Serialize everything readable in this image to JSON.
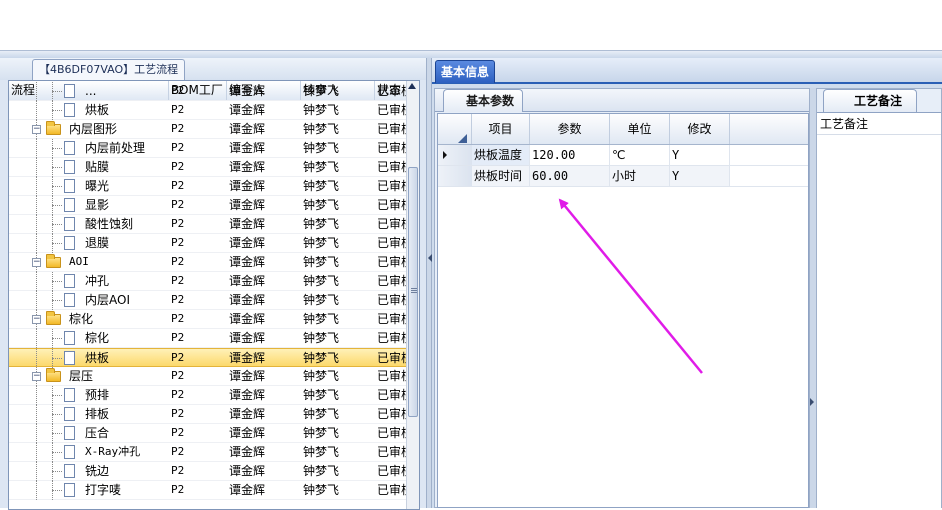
{
  "left_tab_label": "【4B6DF07VAO】工艺流程",
  "tree_grid": {
    "columns": [
      "流程",
      "BOM工厂",
      "编写人",
      "核审人",
      "状态"
    ],
    "rows": [
      {
        "label": "...",
        "level": 2,
        "type": "doc",
        "factory": "P2",
        "writer": "谭金辉",
        "reviewer": "钟梦飞",
        "status": "已审核"
      },
      {
        "label": "烘板",
        "level": 2,
        "type": "doc",
        "factory": "P2",
        "writer": "谭金辉",
        "reviewer": "钟梦飞",
        "status": "已审核"
      },
      {
        "label": "内层图形",
        "level": 1,
        "type": "folder",
        "factory": "P2",
        "writer": "谭金辉",
        "reviewer": "钟梦飞",
        "status": "已审核"
      },
      {
        "label": "内层前处理",
        "level": 2,
        "type": "doc",
        "factory": "P2",
        "writer": "谭金辉",
        "reviewer": "钟梦飞",
        "status": "已审核"
      },
      {
        "label": "贴膜",
        "level": 2,
        "type": "doc",
        "factory": "P2",
        "writer": "谭金辉",
        "reviewer": "钟梦飞",
        "status": "已审核"
      },
      {
        "label": "曝光",
        "level": 2,
        "type": "doc",
        "factory": "P2",
        "writer": "谭金辉",
        "reviewer": "钟梦飞",
        "status": "已审核"
      },
      {
        "label": "显影",
        "level": 2,
        "type": "doc",
        "factory": "P2",
        "writer": "谭金辉",
        "reviewer": "钟梦飞",
        "status": "已审核"
      },
      {
        "label": "酸性蚀刻",
        "level": 2,
        "type": "doc",
        "factory": "P2",
        "writer": "谭金辉",
        "reviewer": "钟梦飞",
        "status": "已审核"
      },
      {
        "label": "退膜",
        "level": 2,
        "type": "doc",
        "factory": "P2",
        "writer": "谭金辉",
        "reviewer": "钟梦飞",
        "status": "已审核"
      },
      {
        "label": "AOI",
        "level": 1,
        "type": "folder",
        "factory": "P2",
        "writer": "谭金辉",
        "reviewer": "钟梦飞",
        "status": "已审核"
      },
      {
        "label": "冲孔",
        "level": 2,
        "type": "doc",
        "factory": "P2",
        "writer": "谭金辉",
        "reviewer": "钟梦飞",
        "status": "已审核"
      },
      {
        "label": "内层AOI",
        "level": 2,
        "type": "doc",
        "factory": "P2",
        "writer": "谭金辉",
        "reviewer": "钟梦飞",
        "status": "已审核"
      },
      {
        "label": "棕化",
        "level": 1,
        "type": "folder",
        "factory": "P2",
        "writer": "谭金辉",
        "reviewer": "钟梦飞",
        "status": "已审核"
      },
      {
        "label": "棕化",
        "level": 2,
        "type": "doc",
        "factory": "P2",
        "writer": "谭金辉",
        "reviewer": "钟梦飞",
        "status": "已审核"
      },
      {
        "label": "烘板",
        "level": 2,
        "type": "doc",
        "factory": "P2",
        "writer": "谭金辉",
        "reviewer": "钟梦飞",
        "status": "已审核",
        "selected": true
      },
      {
        "label": "层压",
        "level": 1,
        "type": "folder",
        "factory": "P2",
        "writer": "谭金辉",
        "reviewer": "钟梦飞",
        "status": "已审核"
      },
      {
        "label": "预排",
        "level": 2,
        "type": "doc",
        "factory": "P2",
        "writer": "谭金辉",
        "reviewer": "钟梦飞",
        "status": "已审核"
      },
      {
        "label": "排板",
        "level": 2,
        "type": "doc",
        "factory": "P2",
        "writer": "谭金辉",
        "reviewer": "钟梦飞",
        "status": "已审核"
      },
      {
        "label": "压合",
        "level": 2,
        "type": "doc",
        "factory": "P2",
        "writer": "谭金辉",
        "reviewer": "钟梦飞",
        "status": "已审核"
      },
      {
        "label": "X-Ray冲孔",
        "level": 2,
        "type": "doc",
        "factory": "P2",
        "writer": "谭金辉",
        "reviewer": "钟梦飞",
        "status": "已审核"
      },
      {
        "label": "铣边",
        "level": 2,
        "type": "doc",
        "factory": "P2",
        "writer": "谭金辉",
        "reviewer": "钟梦飞",
        "status": "已审核"
      },
      {
        "label": "打字唛",
        "level": 2,
        "type": "doc",
        "factory": "P2",
        "writer": "谭金辉",
        "reviewer": "钟梦飞",
        "status": "已审核"
      }
    ]
  },
  "right_tab_label": "基本信息",
  "params_tab_label": "基本参数",
  "params_grid": {
    "columns": [
      "项目",
      "参数",
      "单位",
      "修改"
    ],
    "rows": [
      {
        "item": "烘板温度",
        "value": "120.00",
        "unit": "℃",
        "modify": "Y",
        "current": true
      },
      {
        "item": "烘板时间",
        "value": "60.00",
        "unit": "小时",
        "modify": "Y"
      }
    ]
  },
  "notes_tab_label": "工艺备注",
  "notes_label": "工艺备注",
  "annotation_arrow_color": "#e01ce8"
}
